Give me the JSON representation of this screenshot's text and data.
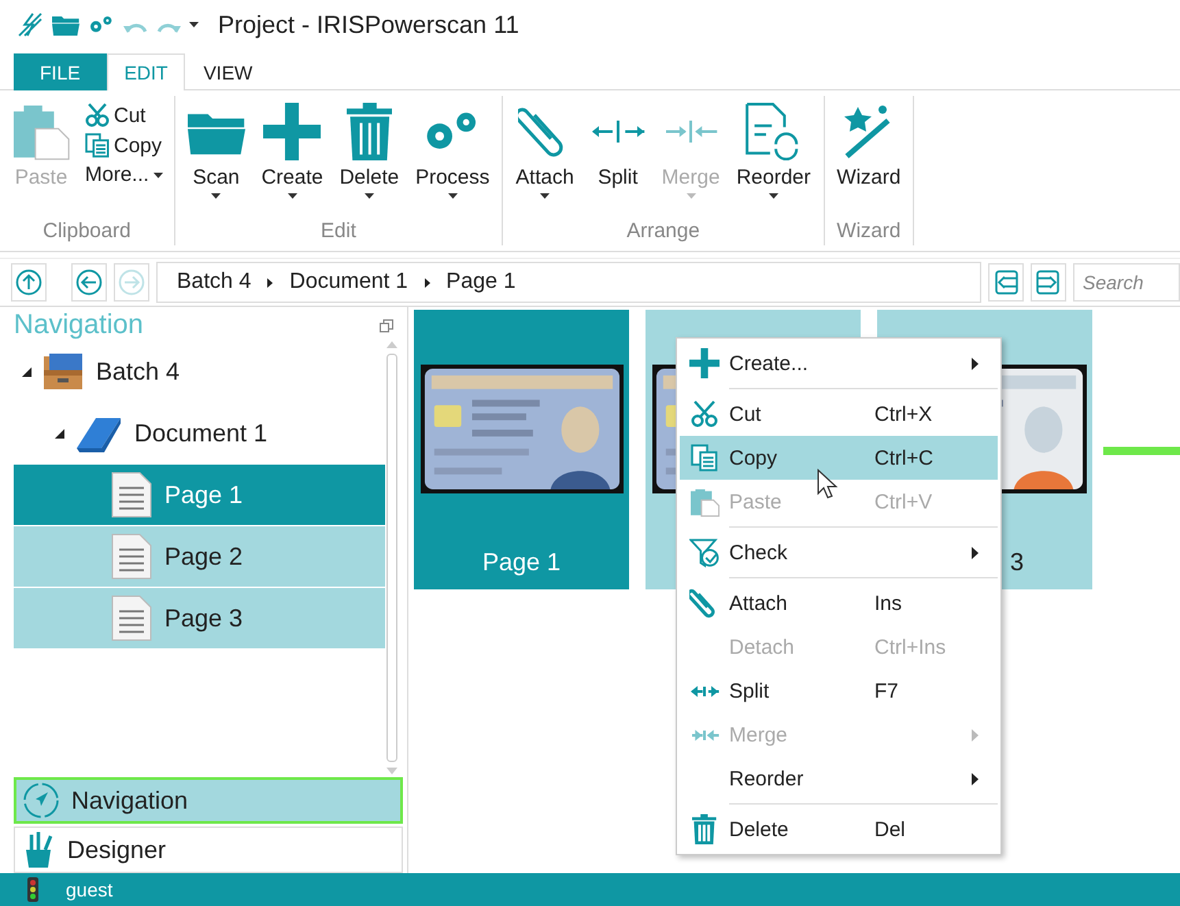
{
  "window": {
    "title": "Project - IRISPowerscan 11"
  },
  "tabs": [
    {
      "label": "FILE",
      "kind": "file",
      "selected": false
    },
    {
      "label": "EDIT",
      "kind": "tab",
      "selected": true
    },
    {
      "label": "VIEW",
      "kind": "tab",
      "selected": false
    }
  ],
  "ribbon": {
    "groups": [
      {
        "label": "Clipboard",
        "items": [
          {
            "label": "Paste",
            "kind": "large",
            "disabled": true,
            "dropdown": false
          },
          {
            "label": "Cut",
            "kind": "small",
            "disabled": false,
            "dropdown": false
          },
          {
            "label": "Copy",
            "kind": "small",
            "disabled": false,
            "dropdown": false
          },
          {
            "label": "More...",
            "kind": "small",
            "disabled": false,
            "dropdown": true
          }
        ]
      },
      {
        "label": "Edit",
        "items": [
          {
            "label": "Scan",
            "kind": "large",
            "disabled": false,
            "dropdown": true
          },
          {
            "label": "Create",
            "kind": "large",
            "disabled": false,
            "dropdown": true
          },
          {
            "label": "Delete",
            "kind": "large",
            "disabled": false,
            "dropdown": true
          },
          {
            "label": "Process",
            "kind": "large",
            "disabled": false,
            "dropdown": true
          }
        ]
      },
      {
        "label": "Arrange",
        "items": [
          {
            "label": "Attach",
            "kind": "large",
            "disabled": false,
            "dropdown": true
          },
          {
            "label": "Split",
            "kind": "large",
            "disabled": false,
            "dropdown": false
          },
          {
            "label": "Merge",
            "kind": "large",
            "disabled": true,
            "dropdown": true
          },
          {
            "label": "Reorder",
            "kind": "large",
            "disabled": false,
            "dropdown": true
          }
        ]
      },
      {
        "label": "Wizard",
        "items": [
          {
            "label": "Wizard",
            "kind": "large",
            "disabled": false,
            "dropdown": false
          }
        ]
      }
    ]
  },
  "path_bar": {
    "back_disabled": false,
    "forward_disabled": true,
    "crumbs": [
      "Batch 4",
      "Document 1",
      "Page 1"
    ],
    "search": {
      "placeholder": "Search"
    }
  },
  "navigation": {
    "title": "Navigation",
    "tree": [
      {
        "label": "Batch 4",
        "kind": "batch",
        "expanded": true,
        "children": [
          {
            "label": "Document 1",
            "kind": "document",
            "expanded": true,
            "children": [
              {
                "label": "Page 1",
                "kind": "page",
                "selected": true,
                "current": true
              },
              {
                "label": "Page 2",
                "kind": "page",
                "selected": true,
                "current": false
              },
              {
                "label": "Page 3",
                "kind": "page",
                "selected": true,
                "current": false
              }
            ]
          }
        ]
      }
    ],
    "panels": [
      {
        "label": "Navigation",
        "selected": true
      },
      {
        "label": "Designer",
        "selected": false
      }
    ]
  },
  "thumbnails": [
    {
      "label": "Page 1",
      "selected": true,
      "current": true
    },
    {
      "selected": true,
      "current": false
    },
    {
      "label": "3",
      "selected": true,
      "current": false
    }
  ],
  "context_menu": [
    {
      "kind": "item",
      "label": "Create...",
      "submenu": true,
      "disabled": false,
      "selected": false
    },
    {
      "kind": "separator"
    },
    {
      "kind": "item",
      "label": "Cut",
      "shortcut": "Ctrl+X",
      "submenu": false,
      "disabled": false,
      "selected": false
    },
    {
      "kind": "item",
      "label": "Copy",
      "shortcut": "Ctrl+C",
      "submenu": false,
      "disabled": false,
      "selected": true
    },
    {
      "kind": "item",
      "label": "Paste",
      "shortcut": "Ctrl+V",
      "submenu": false,
      "disabled": true,
      "selected": false
    },
    {
      "kind": "separator"
    },
    {
      "kind": "item",
      "label": "Check",
      "submenu": true,
      "disabled": false,
      "selected": false
    },
    {
      "kind": "separator"
    },
    {
      "kind": "item",
      "label": "Attach",
      "shortcut": "Ins",
      "submenu": false,
      "disabled": false,
      "selected": false
    },
    {
      "kind": "item",
      "label": "Detach",
      "shortcut": "Ctrl+Ins",
      "submenu": false,
      "disabled": true,
      "selected": false
    },
    {
      "kind": "item",
      "label": "Split",
      "shortcut": "F7",
      "submenu": false,
      "disabled": false,
      "selected": false
    },
    {
      "kind": "item",
      "label": "Merge",
      "submenu": true,
      "disabled": true,
      "selected": false
    },
    {
      "kind": "item",
      "label": "Reorder",
      "submenu": true,
      "disabled": false,
      "selected": false
    },
    {
      "kind": "separator"
    },
    {
      "kind": "item",
      "label": "Delete",
      "shortcut": "Del",
      "submenu": false,
      "disabled": false,
      "selected": false
    }
  ],
  "status_bar": {
    "user": "guest"
  }
}
